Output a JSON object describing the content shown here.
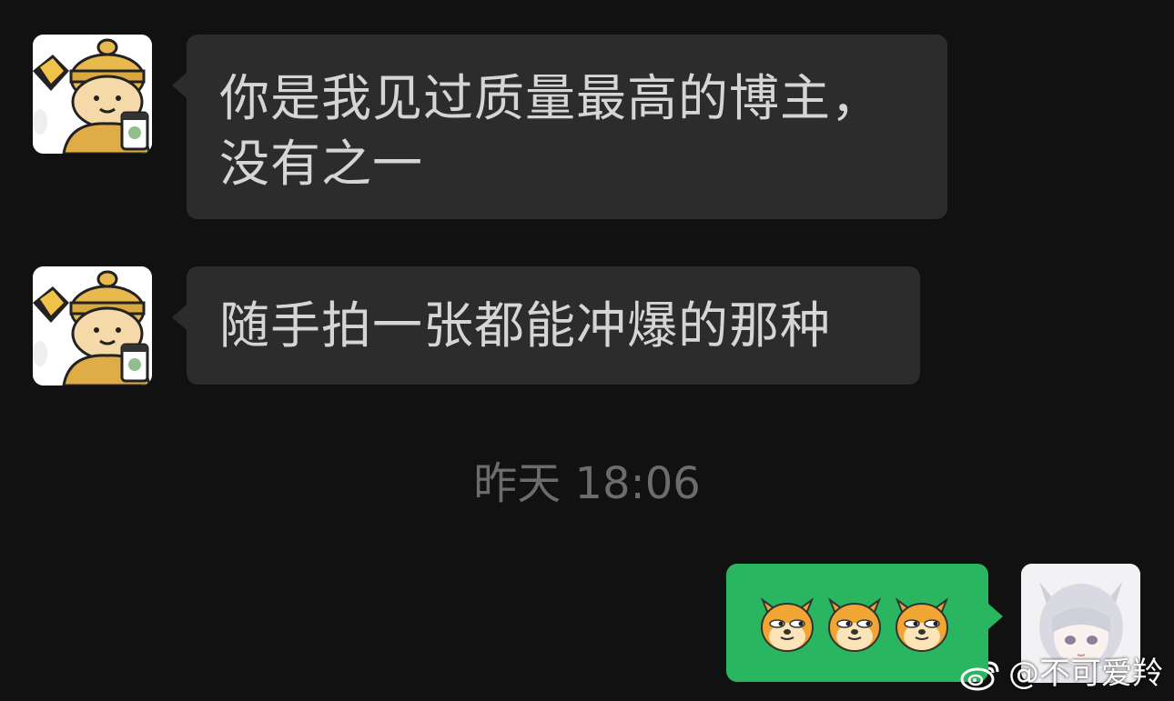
{
  "messages": [
    {
      "sender": "other",
      "text": "你是我见过质量最高的博主，\n没有之一"
    },
    {
      "sender": "other",
      "text": "随手拍一张都能冲爆的那种"
    },
    {
      "sender": "me",
      "emoji": [
        "doge-emoji",
        "doge-emoji",
        "doge-emoji"
      ]
    }
  ],
  "timestamp": "昨天 18:06",
  "watermark": {
    "icon": "weibo-logo-icon",
    "text": "@不可爱羚"
  },
  "colors": {
    "background": "#111111",
    "incoming_bubble": "#2c2c2c",
    "outgoing_bubble": "#2ab560",
    "incoming_text": "#d5d5d5",
    "timestamp_text": "#6c6c6c"
  }
}
